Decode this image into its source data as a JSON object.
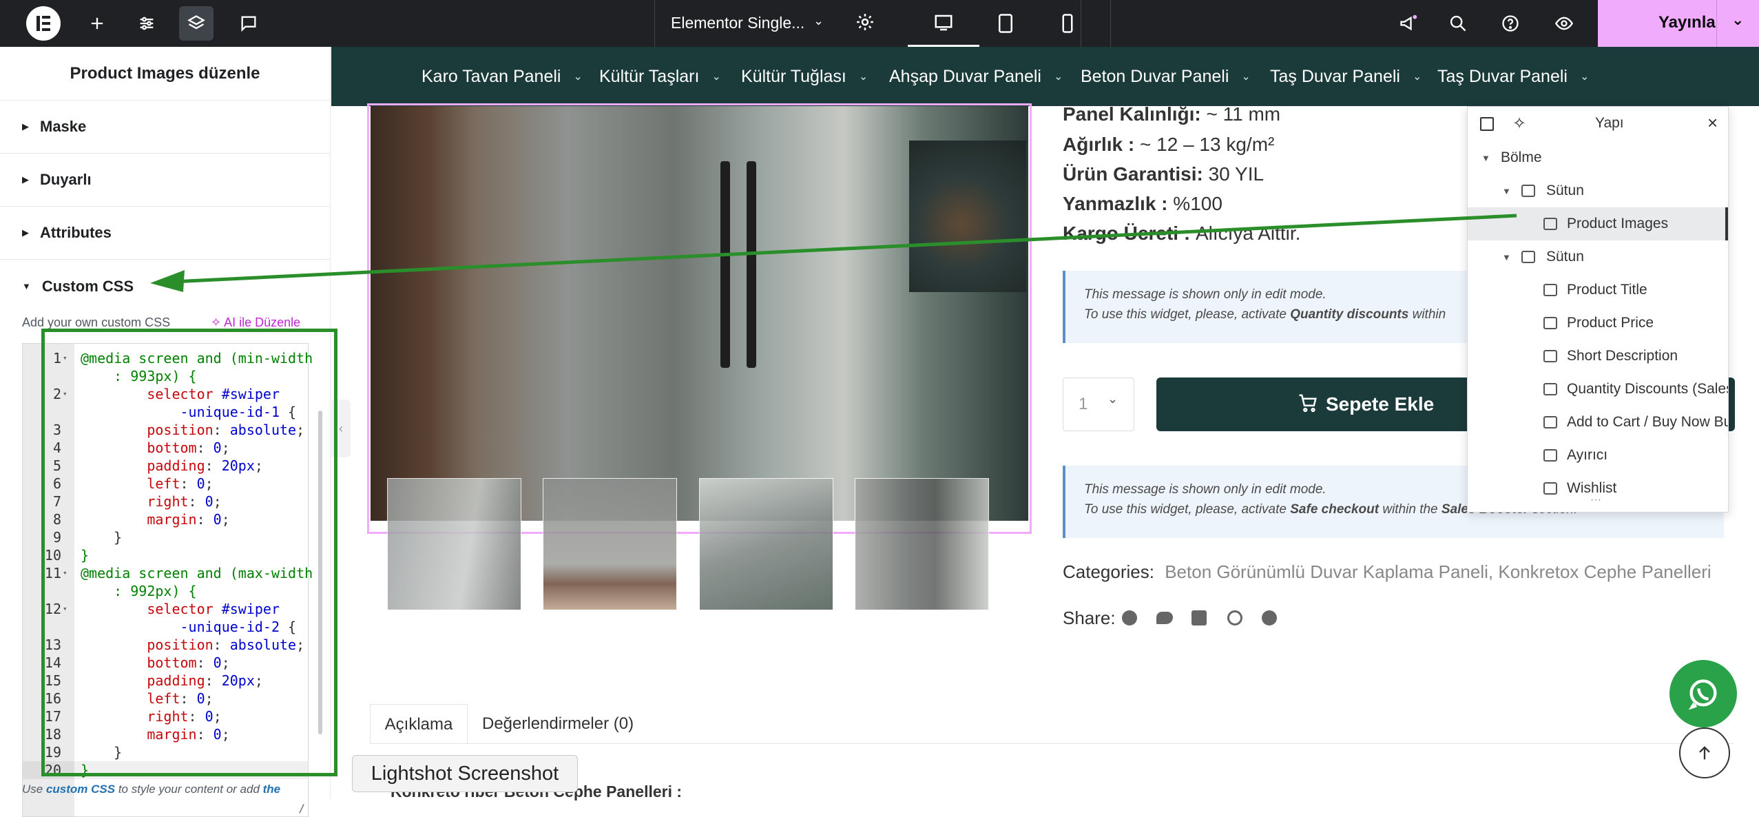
{
  "topbar": {
    "document_title": "Elementor Single...",
    "publish_label": "Yayınla",
    "logo": "elementor-logo"
  },
  "sidebar": {
    "title": "Product Images düzenle",
    "sections": [
      "Maske",
      "Duyarlı",
      "Attributes",
      "Custom CSS"
    ],
    "custom_css_label": "Add your own custom CSS",
    "ai_label": "AI ile Düzenle",
    "footer_text_1": "Use ",
    "footer_link": "custom CSS",
    "footer_text_2": " to style your content or add ",
    "footer_link_2": "the"
  },
  "code": {
    "lines": [
      {
        "n": "1",
        "fold": true,
        "parts": [
          [
            "kw",
            "@media screen and (min-width"
          ]
        ]
      },
      {
        "n": "",
        "fold": false,
        "parts": [
          [
            "kw",
            "    : 993px) {"
          ]
        ]
      },
      {
        "n": "2",
        "fold": true,
        "parts": [
          [
            "sel",
            "        selector "
          ],
          [
            "val",
            "#swiper"
          ]
        ]
      },
      {
        "n": "",
        "fold": false,
        "parts": [
          [
            "val",
            "            -unique-id-1 "
          ],
          [
            "plain",
            "{"
          ]
        ]
      },
      {
        "n": "3",
        "fold": false,
        "parts": [
          [
            "prop",
            "        position"
          ],
          [
            "plain",
            ": "
          ],
          [
            "val",
            "absolute"
          ],
          [
            "plain",
            ";"
          ]
        ]
      },
      {
        "n": "4",
        "fold": false,
        "parts": [
          [
            "prop",
            "        bottom"
          ],
          [
            "plain",
            ": "
          ],
          [
            "val",
            "0"
          ],
          [
            "plain",
            ";"
          ]
        ]
      },
      {
        "n": "5",
        "fold": false,
        "parts": [
          [
            "prop",
            "        padding"
          ],
          [
            "plain",
            ": "
          ],
          [
            "val",
            "20px"
          ],
          [
            "plain",
            ";"
          ]
        ]
      },
      {
        "n": "6",
        "fold": false,
        "parts": [
          [
            "prop",
            "        left"
          ],
          [
            "plain",
            ": "
          ],
          [
            "val",
            "0"
          ],
          [
            "plain",
            ";"
          ]
        ]
      },
      {
        "n": "7",
        "fold": false,
        "parts": [
          [
            "prop",
            "        right"
          ],
          [
            "plain",
            ": "
          ],
          [
            "val",
            "0"
          ],
          [
            "plain",
            ";"
          ]
        ]
      },
      {
        "n": "8",
        "fold": false,
        "parts": [
          [
            "prop",
            "        margin"
          ],
          [
            "plain",
            ": "
          ],
          [
            "val",
            "0"
          ],
          [
            "plain",
            ";"
          ]
        ]
      },
      {
        "n": "9",
        "fold": false,
        "parts": [
          [
            "plain",
            "    }"
          ]
        ]
      },
      {
        "n": "10",
        "fold": false,
        "parts": [
          [
            "kw",
            "}"
          ]
        ]
      },
      {
        "n": "11",
        "fold": true,
        "parts": [
          [
            "kw",
            "@media screen and (max-width"
          ]
        ]
      },
      {
        "n": "",
        "fold": false,
        "parts": [
          [
            "kw",
            "    : 992px) {"
          ]
        ]
      },
      {
        "n": "12",
        "fold": true,
        "parts": [
          [
            "sel",
            "        selector "
          ],
          [
            "val",
            "#swiper"
          ]
        ]
      },
      {
        "n": "",
        "fold": false,
        "parts": [
          [
            "val",
            "            -unique-id-2 "
          ],
          [
            "plain",
            "{"
          ]
        ]
      },
      {
        "n": "13",
        "fold": false,
        "parts": [
          [
            "prop",
            "        position"
          ],
          [
            "plain",
            ": "
          ],
          [
            "val",
            "absolute"
          ],
          [
            "plain",
            ";"
          ]
        ]
      },
      {
        "n": "14",
        "fold": false,
        "parts": [
          [
            "prop",
            "        bottom"
          ],
          [
            "plain",
            ": "
          ],
          [
            "val",
            "0"
          ],
          [
            "plain",
            ";"
          ]
        ]
      },
      {
        "n": "15",
        "fold": false,
        "parts": [
          [
            "prop",
            "        padding"
          ],
          [
            "plain",
            ": "
          ],
          [
            "val",
            "20px"
          ],
          [
            "plain",
            ";"
          ]
        ]
      },
      {
        "n": "16",
        "fold": false,
        "parts": [
          [
            "prop",
            "        left"
          ],
          [
            "plain",
            ": "
          ],
          [
            "val",
            "0"
          ],
          [
            "plain",
            ";"
          ]
        ]
      },
      {
        "n": "17",
        "fold": false,
        "parts": [
          [
            "prop",
            "        right"
          ],
          [
            "plain",
            ": "
          ],
          [
            "val",
            "0"
          ],
          [
            "plain",
            ";"
          ]
        ]
      },
      {
        "n": "18",
        "fold": false,
        "parts": [
          [
            "prop",
            "        margin"
          ],
          [
            "plain",
            ": "
          ],
          [
            "val",
            "0"
          ],
          [
            "plain",
            ";"
          ]
        ]
      },
      {
        "n": "19",
        "fold": false,
        "parts": [
          [
            "plain",
            "    }"
          ]
        ]
      },
      {
        "n": "20",
        "fold": false,
        "parts": [
          [
            "kw",
            "}"
          ]
        ]
      }
    ]
  },
  "nav": [
    "Karo Tavan Paneli",
    "Kültür Taşları",
    "Kültür Tuğlası",
    "Ahşap Duvar Paneli",
    "Beton Duvar Paneli",
    "Taş Duvar Paneli",
    "Taş Duvar Paneli"
  ],
  "product": {
    "specs": [
      {
        "label": "Panel Kalınlığı: ",
        "value": "~  11 mm"
      },
      {
        "label": "Ağırlık : ",
        "value": "~ 12 – 13 kg/m²"
      },
      {
        "label": "Ürün Garantisi: ",
        "value": "30 YIL"
      },
      {
        "label": "Yanmazlık : ",
        "value": "%100"
      },
      {
        "label": "Kargo Ücreti : ",
        "value": "Alıcıya Aittir."
      }
    ],
    "notice1_line1": "This message is shown only in edit mode.",
    "notice1_line2a": "To use this widget, please, activate ",
    "notice1_bold": "Quantity discounts",
    "notice1_line2b": " within",
    "qty_value": "1",
    "add_to_cart": "Sepete Ekle",
    "notice2_line1": "This message is shown only in edit mode.",
    "notice2_line2a": "To use this widget, please, activate ",
    "notice2_bold": "Safe checkout",
    "notice2_line2b": " within the ",
    "notice2_bold2": "Sales Booster",
    "notice2_line2c": " section.",
    "categories_label": "Categories:",
    "categories_value": "Beton Görünümlü Duvar Kaplama Paneli, Konkretox Cephe Panelleri",
    "share_label": "Share:",
    "tabs": [
      "Açıklama",
      "Değerlendirmeler (0)"
    ],
    "bottom_text": "Konkreto   riber Beton Cephe Panelleri :"
  },
  "structure": {
    "title": "Yapı",
    "items": [
      {
        "label": "Bölme",
        "depth": 0,
        "caret": true,
        "icon": "none"
      },
      {
        "label": "Sütun",
        "depth": 1,
        "caret": true,
        "icon": "column-icon"
      },
      {
        "label": "Product Images",
        "depth": 2,
        "caret": false,
        "icon": "image-icon",
        "selected": true
      },
      {
        "label": "Sütun",
        "depth": 1,
        "caret": true,
        "icon": "column-icon"
      },
      {
        "label": "Product Title",
        "depth": 2,
        "caret": false,
        "icon": "title-icon"
      },
      {
        "label": "Product Price",
        "depth": 2,
        "caret": false,
        "icon": "price-icon"
      },
      {
        "label": "Short Description",
        "depth": 2,
        "caret": false,
        "icon": "description-icon"
      },
      {
        "label": "Quantity Discounts (Sales ...",
        "depth": 2,
        "caret": false,
        "icon": "chart-icon"
      },
      {
        "label": "Add to Cart / Buy Now Butt...",
        "depth": 2,
        "caret": false,
        "icon": "cart-button-icon"
      },
      {
        "label": "Ayırıcı",
        "depth": 2,
        "caret": false,
        "icon": "divider-icon"
      },
      {
        "label": "Wishlist",
        "depth": 2,
        "caret": false,
        "icon": "heart-icon"
      }
    ]
  },
  "lightshot": "Lightshot Screenshot",
  "colors": {
    "topbar": "#1f2124",
    "publish": "#f0abfc",
    "nav": "#1b3a3a",
    "annotation": "#2a8f2a",
    "selection_outline": "#f0abfc"
  }
}
